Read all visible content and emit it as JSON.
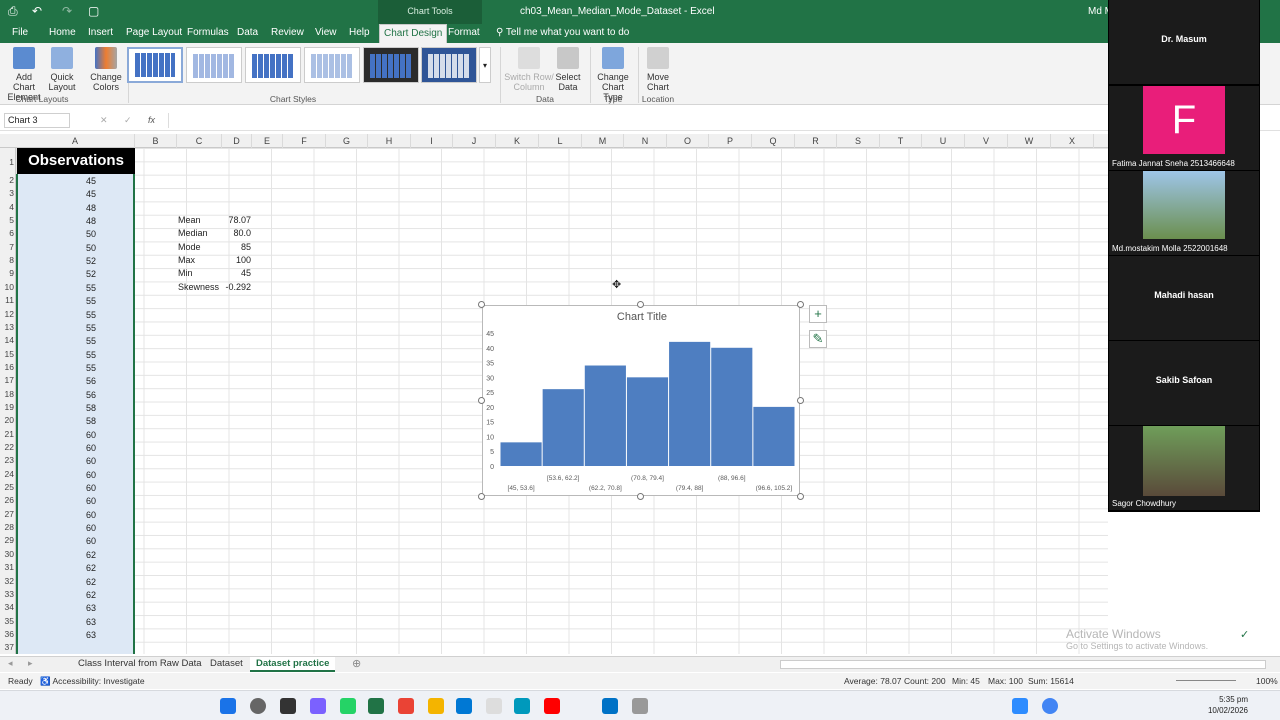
{
  "window": {
    "title": "ch03_Mean_Median_Mode_Dataset - Excel",
    "user": "Md M",
    "context_tab": "Chart Tools"
  },
  "quick_access": {
    "save": "⎙",
    "undo": "↶",
    "redo": "↷",
    "new": "▢"
  },
  "ribbon_tabs": [
    "File",
    "Home",
    "Insert",
    "Page Layout",
    "Formulas",
    "Data",
    "Review",
    "View",
    "Help",
    "Chart Design",
    "Format"
  ],
  "tell_me": "Tell me what you want to do",
  "ribbon": {
    "add_chart_element": "Add Chart Element",
    "quick_layout": "Quick Layout",
    "change_colors": "Change Colors",
    "switch_row_col": "Switch Row/ Column",
    "select_data": "Select Data",
    "change_chart_type": "Change Chart Type",
    "move_chart": "Move Chart",
    "groups": {
      "chart_layouts": "Chart Layouts",
      "chart_styles": "Chart Styles",
      "data": "Data",
      "type": "Type",
      "location": "Location"
    }
  },
  "formula_bar": {
    "name_box": "Chart 3",
    "fx": "fx",
    "cancel": "✕",
    "enter": "✓"
  },
  "columns": [
    "A",
    "B",
    "C",
    "D",
    "E",
    "F",
    "G",
    "H",
    "I",
    "J",
    "K",
    "L",
    "M",
    "N",
    "O",
    "P",
    "Q",
    "R",
    "S",
    "T",
    "U",
    "V",
    "W",
    "X"
  ],
  "rows": [
    "1",
    "2",
    "3",
    "4",
    "5",
    "6",
    "7",
    "8",
    "9",
    "10",
    "11",
    "12",
    "13",
    "14",
    "15",
    "16",
    "17",
    "18",
    "19",
    "20",
    "21",
    "22",
    "23",
    "24",
    "25",
    "26",
    "27",
    "28",
    "29",
    "30",
    "31",
    "32",
    "33",
    "34",
    "35",
    "36",
    "37"
  ],
  "header_cell": "Observations",
  "observations": [
    "45",
    "45",
    "48",
    "48",
    "50",
    "50",
    "52",
    "52",
    "55",
    "55",
    "55",
    "55",
    "55",
    "55",
    "55",
    "56",
    "56",
    "58",
    "58",
    "60",
    "60",
    "60",
    "60",
    "60",
    "60",
    "60",
    "60",
    "60",
    "62",
    "62",
    "62",
    "62",
    "63",
    "63",
    "63"
  ],
  "stats": [
    {
      "label": "Mean",
      "value": "78.07"
    },
    {
      "label": "Median",
      "value": "80.0"
    },
    {
      "label": "Mode",
      "value": "85"
    },
    {
      "label": "Max",
      "value": "100"
    },
    {
      "label": "Min",
      "value": "45"
    },
    {
      "label": "Skewness",
      "value": "-0.292"
    }
  ],
  "chart_data": {
    "type": "bar",
    "title": "Chart Title",
    "categories": [
      "[45, 53.6]",
      "[53.6, 62.2]",
      "(62.2, 70.8]",
      "(70.8, 79.4]",
      "(79.4, 88]",
      "(88, 96.6]",
      "(96.6, 105.2]"
    ],
    "values": [
      8,
      26,
      34,
      30,
      42,
      40,
      20
    ],
    "yticks": [
      "0",
      "5",
      "10",
      "15",
      "20",
      "25",
      "30",
      "35",
      "40",
      "45"
    ],
    "ylim": [
      0,
      45
    ],
    "color": "#4e7ec1"
  },
  "chart_buttons": {
    "add": "+",
    "style": "✎"
  },
  "sheet_tabs": [
    "Class Interval from Raw Data",
    "Dataset",
    "Dataset practice"
  ],
  "status": {
    "ready": "Ready",
    "accessibility": "Accessibility: Investigate",
    "average": "Average: 78.07",
    "count": "Count: 200",
    "min": "Min: 45",
    "max": "Max: 100",
    "sum": "Sum: 15614",
    "zoom": "100%"
  },
  "watermark": {
    "title": "Activate Windows",
    "sub": "Go to Settings to activate Windows."
  },
  "taskbar": {
    "time": "5:35 pm",
    "date": "10/02/2026"
  },
  "participants": [
    {
      "name": "Dr. Masum",
      "caption": ""
    },
    {
      "name": "F",
      "caption": "Fatima Jannat Sneha 2513466648"
    },
    {
      "name": "",
      "caption": "Md.mostakim Molla 2522001648"
    },
    {
      "name": "Mahadi hasan",
      "caption": ""
    },
    {
      "name": "Sakib Safoan",
      "caption": ""
    },
    {
      "name": "",
      "caption": "Sagor Chowdhury"
    }
  ]
}
